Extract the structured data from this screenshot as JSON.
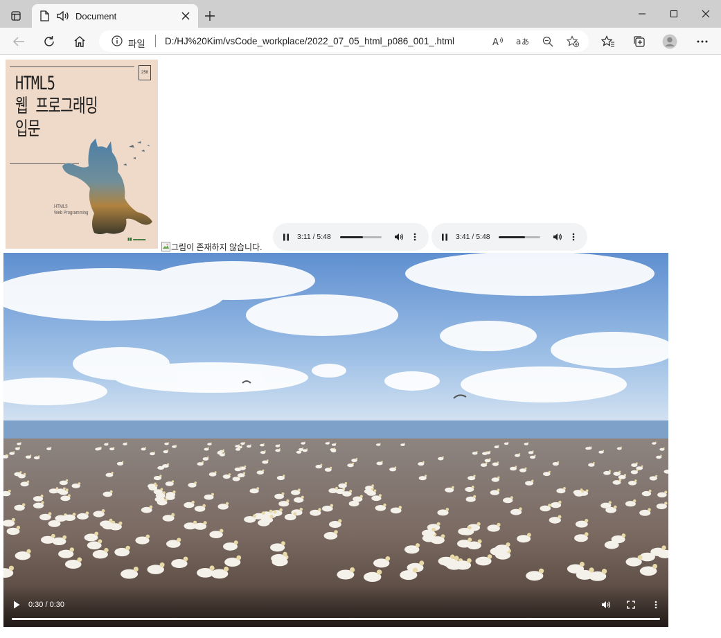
{
  "browser": {
    "tab": {
      "title": "Document"
    },
    "address": {
      "scheme_label": "파일",
      "url": "D:/HJ%20Kim/vsCode_workplace/2022_07_05_html_p086_001_.html"
    },
    "colors": {
      "tabstrip": "#cfcfcf",
      "toolbar": "#f7f7f7",
      "addressbar": "#ffffff"
    }
  },
  "page": {
    "book_cover": {
      "title_lines": "HTML5\n웹 프로그래밍\n입문",
      "edition_badge": "258",
      "subtitle": "HTML5\nWeb Programming",
      "background": "#efd9c9"
    },
    "broken_image": {
      "alt_text": "그림이 존재하지 않습니다."
    },
    "audio_players": [
      {
        "time": "3:11 / 5:48",
        "progress": 0.548
      },
      {
        "time": "3:41 / 5:48",
        "progress": 0.635
      }
    ],
    "video": {
      "time": "0:30 / 0:30",
      "progress": 1.0
    }
  }
}
